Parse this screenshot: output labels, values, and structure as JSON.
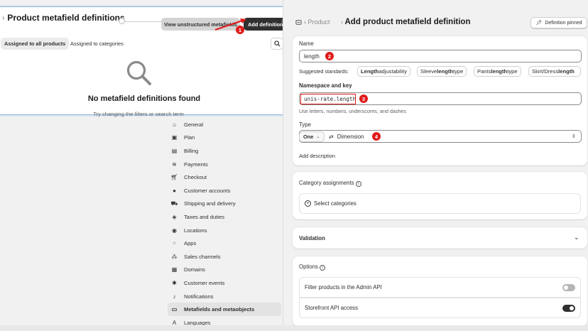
{
  "settings_nav": [
    {
      "label": "General",
      "icon": "store-icon"
    },
    {
      "label": "Plan",
      "icon": "plan-icon"
    },
    {
      "label": "Billing",
      "icon": "billing-icon"
    },
    {
      "label": "Payments",
      "icon": "payments-icon"
    },
    {
      "label": "Checkout",
      "icon": "cart-icon"
    },
    {
      "label": "Customer accounts",
      "icon": "person-icon"
    },
    {
      "label": "Shipping and delivery",
      "icon": "truck-icon"
    },
    {
      "label": "Taxes and duties",
      "icon": "tax-icon"
    },
    {
      "label": "Locations",
      "icon": "location-icon"
    },
    {
      "label": "Apps",
      "icon": "apps-icon"
    },
    {
      "label": "Sales channels",
      "icon": "channels-icon"
    },
    {
      "label": "Domains",
      "icon": "domain-icon"
    },
    {
      "label": "Customer events",
      "icon": "events-icon"
    },
    {
      "label": "Notifications",
      "icon": "bell-icon"
    },
    {
      "label": "Metafields and metaobjects",
      "icon": "metafields-icon",
      "active": true
    },
    {
      "label": "Languages",
      "icon": "language-icon"
    }
  ],
  "popup": {
    "title": "Product metafield definitions",
    "view_unstructured_label": "View unstructured metafields",
    "add_definition_label": "Add definition",
    "help_glyph": "?",
    "tabs": [
      "Assigned to all products",
      "Assigned to categories"
    ],
    "empty_title": "No metafield definitions found",
    "empty_subtitle": "Try changing the filters or search term"
  },
  "header": {
    "breadcrumb": "Product",
    "title": "Add product metafield definition",
    "pin_label": "Definition pinned"
  },
  "form": {
    "name_label": "Name",
    "name_value": "length",
    "suggested_label": "Suggested standards:",
    "suggestions": [
      {
        "bold": "Length",
        "rest": " adjustability"
      },
      {
        "pre": "Sleeve ",
        "bold": "length",
        "rest": " type"
      },
      {
        "pre": "Pants ",
        "bold": "length",
        "rest": " type"
      },
      {
        "pre": "Skirt/Dress ",
        "bold": "length",
        "rest": ""
      }
    ],
    "namespace_label": "Namespace and key",
    "namespace_value": "unis-rate.length",
    "namespace_hint": "Use letters, numbers, underscores, and dashes",
    "type_label": "Type",
    "type_cardinality": "One",
    "type_value": "Dimension",
    "add_description": "Add description"
  },
  "category": {
    "title": "Category assignments",
    "select_label": "Select categories"
  },
  "validation": {
    "title": "Validation"
  },
  "options": {
    "title": "Options",
    "items": [
      {
        "label": "Filter products in the Admin API",
        "on": false
      },
      {
        "label": "Storefront API access",
        "on": true
      }
    ]
  },
  "annotations": [
    "1",
    "2",
    "3",
    "4"
  ],
  "colors": {
    "accent": "#303030",
    "marker": "#e01b1b",
    "popup_border": "#8fb3d9"
  }
}
